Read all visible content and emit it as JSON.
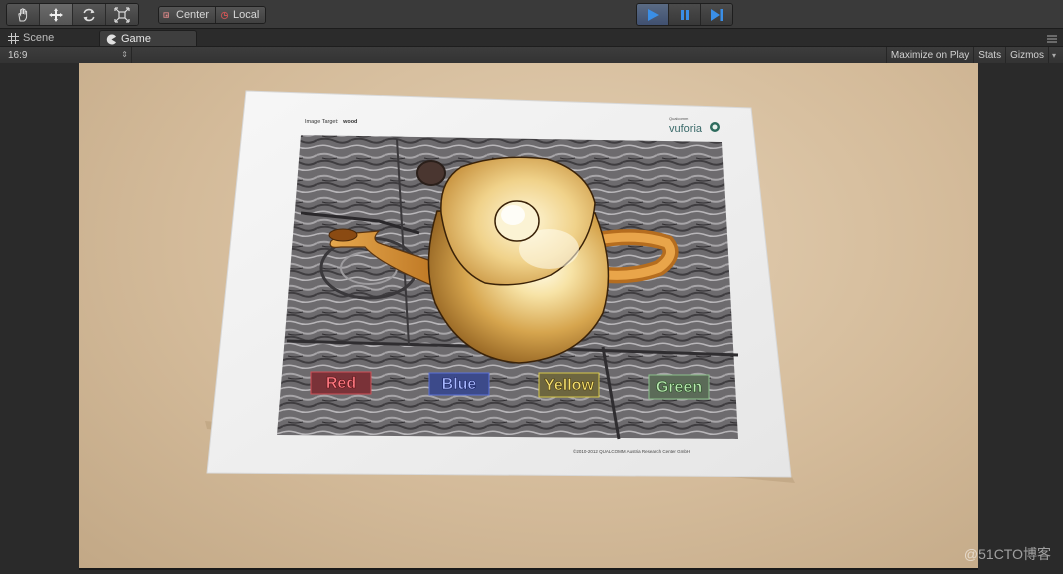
{
  "toolbar": {
    "tools": [
      {
        "name": "hand-tool",
        "icon": "hand-icon"
      },
      {
        "name": "move-tool",
        "icon": "move-icon"
      },
      {
        "name": "rotate-tool",
        "icon": "rotate-icon"
      },
      {
        "name": "scale-tool",
        "icon": "scale-icon"
      }
    ],
    "pivot_label": "Center",
    "rotation_label": "Local",
    "play_icons": [
      "play-icon",
      "pause-icon",
      "step-icon"
    ]
  },
  "tabs": {
    "scene_label": "Scene",
    "game_label": "Game"
  },
  "game_bar": {
    "aspect": "16:9",
    "maximize_label": "Maximize on Play",
    "stats_label": "Stats",
    "gizmos_label": "Gizmos"
  },
  "target_sheet": {
    "header_left_prefix": "Image Target:",
    "header_left_value": "wood",
    "brand_small": "Qualcomm",
    "brand": "vuforia",
    "buttons": [
      {
        "label": "Red",
        "color": "#c0303a"
      },
      {
        "label": "Blue",
        "color": "#3048c0"
      },
      {
        "label": "Yellow",
        "color": "#d8c040"
      },
      {
        "label": "Green",
        "color": "#50a050"
      }
    ],
    "copyright": "©2010-2012 QUALCOMM Austria Research Center GmbH"
  },
  "watermark": "@51CTO博客",
  "colors": {
    "accent_play": "#3a8ee6",
    "toolbar_bg": "#3a3a3a",
    "teapot": "#e8b850"
  }
}
